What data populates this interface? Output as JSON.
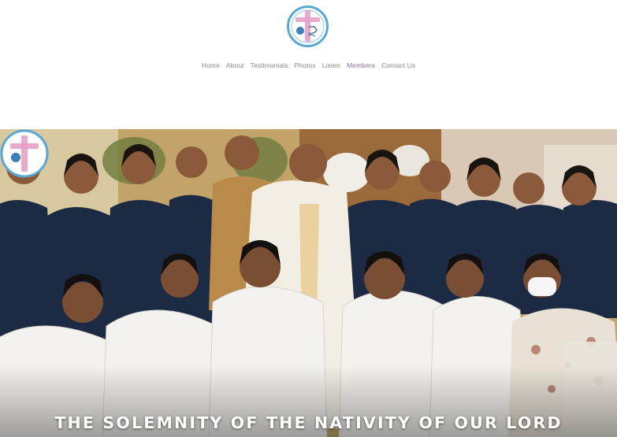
{
  "logo": {
    "icon": "choir-logo-icon",
    "colors": {
      "ring": "#5aa7d4",
      "cross": "#e4a0c6",
      "inner": "#ffffff"
    }
  },
  "nav": {
    "items": [
      {
        "label": "Home"
      },
      {
        "label": "About"
      },
      {
        "label": "Testimonials"
      },
      {
        "label": "Photos"
      },
      {
        "label": "Listen"
      },
      {
        "label": "Members",
        "active": true
      },
      {
        "label": "Contact Us"
      }
    ],
    "color": "#8a8a8a",
    "active_color": "#8a6f9c"
  },
  "hero": {
    "caption": "THE SOLEMNITY OF THE NATIVITY OF OUR LORD",
    "corner_icon": "choir-logo-icon"
  }
}
